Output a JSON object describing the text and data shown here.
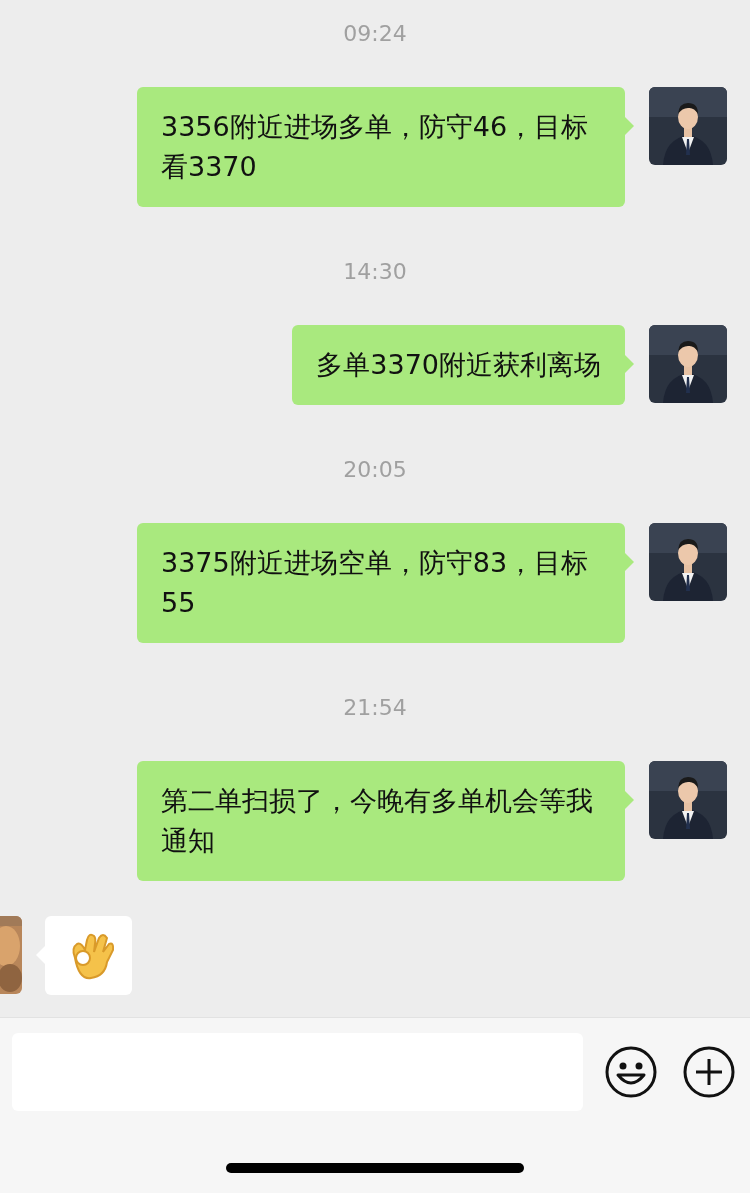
{
  "messages": [
    {
      "kind": "time",
      "text": "09:24"
    },
    {
      "kind": "text",
      "outgoing": true,
      "text": "3356附近进场多单，防守46，目标看3370"
    },
    {
      "kind": "time",
      "text": "14:30"
    },
    {
      "kind": "text",
      "outgoing": true,
      "text": "多单3370附近获利离场"
    },
    {
      "kind": "time",
      "text": "20:05"
    },
    {
      "kind": "text",
      "outgoing": true,
      "text": "3375附近进场空单，防守83，目标55"
    },
    {
      "kind": "time",
      "text": "21:54"
    },
    {
      "kind": "text",
      "outgoing": true,
      "text": "第二单扫损了，今晚有多单机会等我通知"
    },
    {
      "kind": "sticker",
      "outgoing": false
    }
  ]
}
